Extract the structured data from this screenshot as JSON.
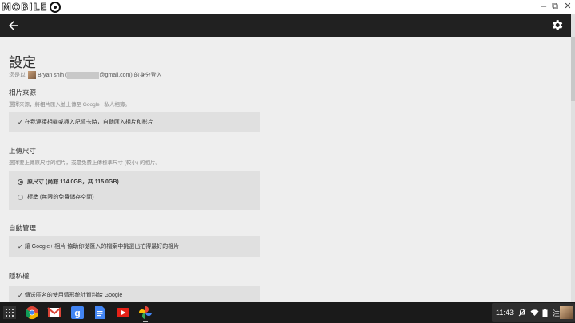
{
  "logo": {
    "text": "MOBILE"
  },
  "window_controls": {
    "minimize": "–",
    "restore": "⧉",
    "close": "✕"
  },
  "appbar": {
    "back_icon": "back-arrow-icon",
    "settings_icon": "gear-icon"
  },
  "page": {
    "title": "設定",
    "signed_in_prefix": "您是以",
    "user_name": "Bryan shih (",
    "email_suffix": "@gmail.com) 的身分登入"
  },
  "sections": {
    "source": {
      "heading": "相片來源",
      "desc": "選擇來源，將相片匯入並上傳至 Google+ 私人相簿。",
      "option": "在我連接相機或插入記憶卡時，自動匯入相片和影片"
    },
    "upload_size": {
      "heading": "上傳尺寸",
      "desc": "選擇要上傳原尺寸的相片，或是免費上傳標準尺寸 (較小) 的相片。",
      "option_full": "原尺寸 (尚餘 114.0GB，共 115.0GB)",
      "option_standard": "標準 (無限的免費儲存空間)"
    },
    "auto": {
      "heading": "自動管理",
      "option": "讓 Google+ 相片 協助你從匯入的檔案中挑選出拍得最好的相片"
    },
    "privacy": {
      "heading": "隱私權",
      "option": "傳送匿名的使用情形統計資料給 Google"
    }
  },
  "shelf": {
    "apps": [
      "chrome-icon",
      "gmail-icon",
      "google-search-icon",
      "docs-icon",
      "youtube-icon",
      "photos-icon"
    ],
    "time": "11:43",
    "ime": "注"
  }
}
